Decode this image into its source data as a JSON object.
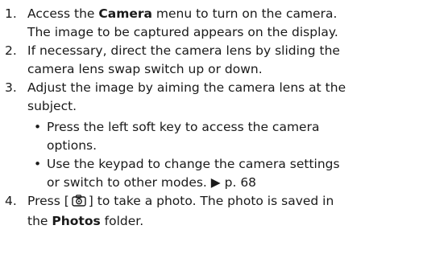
{
  "steps": [
    {
      "num": "1.",
      "pre": "Access the ",
      "bold": "Camera",
      "post": " menu to turn on the camera.",
      "line2": "The image to be captured appears on the display."
    },
    {
      "num": "2.",
      "line1": "If necessary, direct the camera lens by sliding the",
      "line2": "camera lens swap switch up or down."
    },
    {
      "num": "3.",
      "line1": "Adjust the image by aiming the camera lens at the",
      "line2": "subject.",
      "bullets": [
        {
          "mark": "•",
          "line1": "Press the left soft key to access the camera",
          "line2": "options."
        },
        {
          "mark": "•",
          "line1": "Use the keypad to change the camera settings",
          "line2": "or switch to other modes. ▶ p. 68"
        }
      ]
    },
    {
      "num": "4.",
      "pre": "Press [",
      "icon": "camera-key-icon",
      "mid": "] to take a photo. The photo is saved in",
      "line2_pre": "the ",
      "bold": "Photos",
      "line2_post": " folder."
    }
  ]
}
